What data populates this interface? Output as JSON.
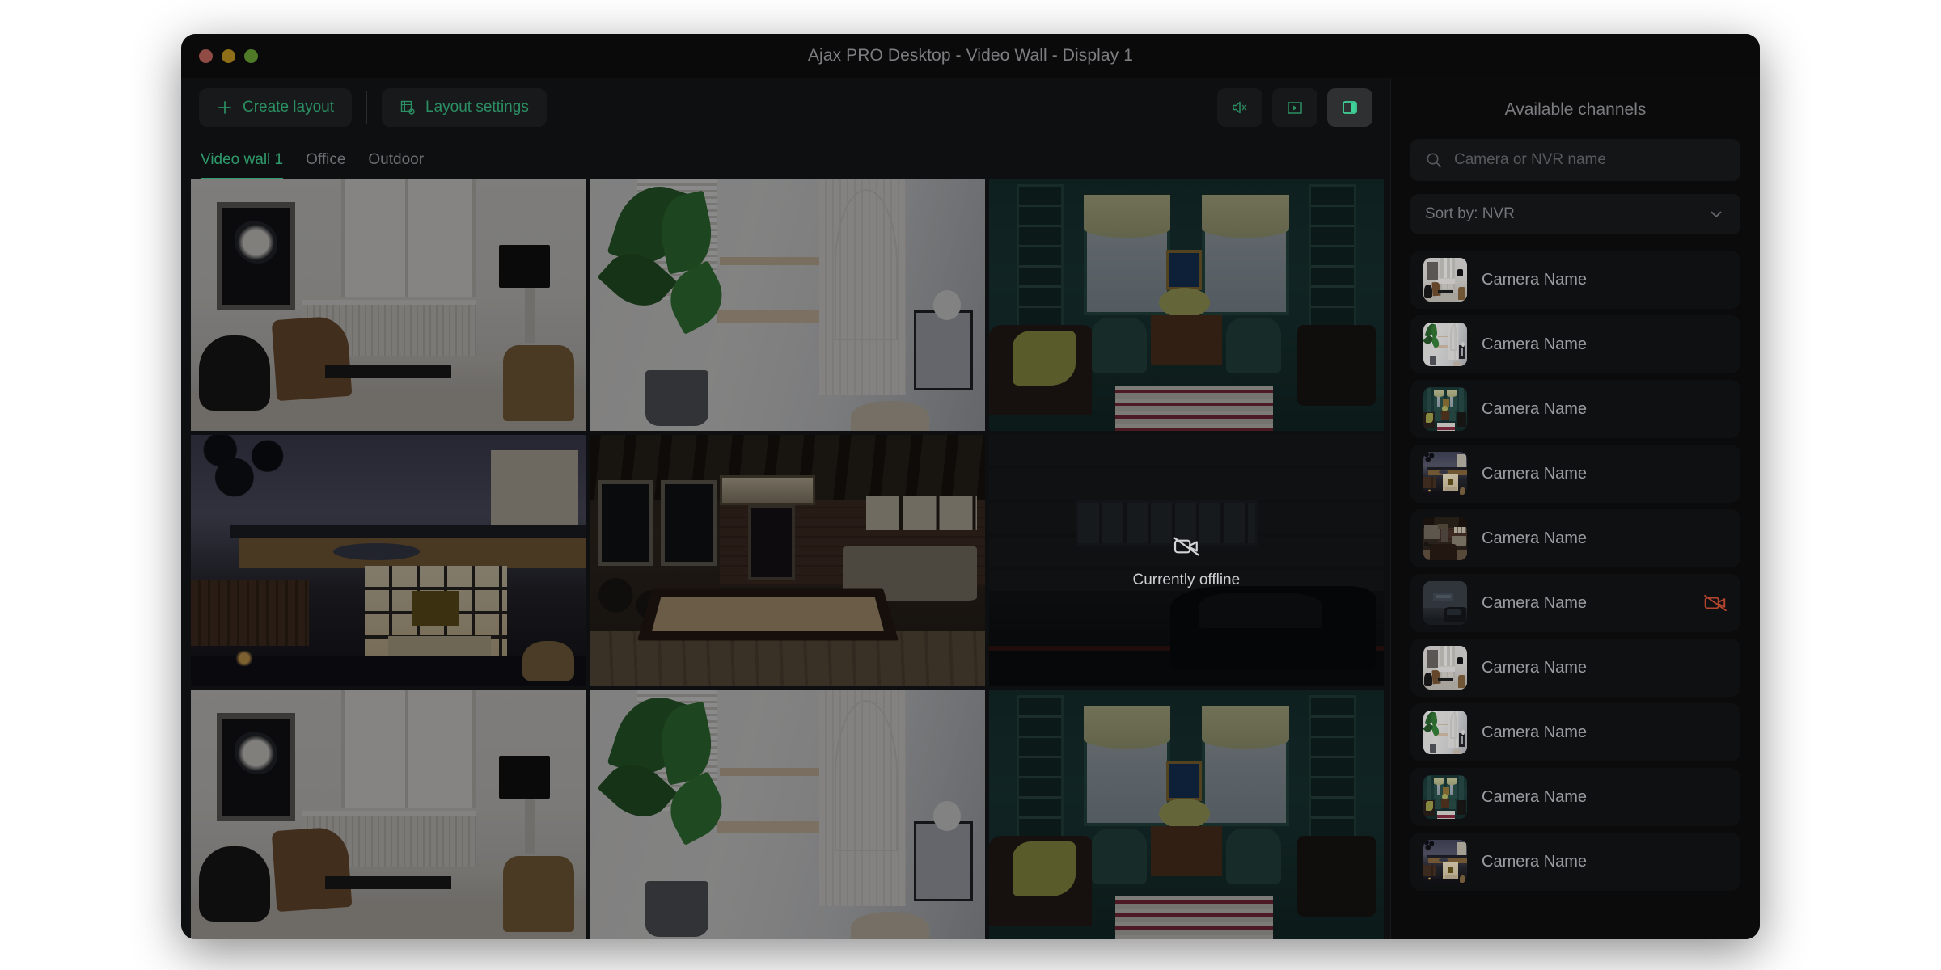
{
  "window": {
    "title": "Ajax PRO Desktop - Video Wall - Display 1",
    "traffic": {
      "close": "close-button",
      "minimize": "minimize-button",
      "maximize": "maximize-button"
    }
  },
  "toolbar": {
    "create_layout": "Create layout",
    "layout_settings": "Layout settings",
    "icons": {
      "create": "plus-icon",
      "settings": "grid-settings-icon",
      "mute": "speaker-muted-icon",
      "play": "play-in-square-icon",
      "panel": "side-panel-toggle-icon"
    }
  },
  "tabs": [
    {
      "label": "Video wall 1",
      "active": true
    },
    {
      "label": "Office",
      "active": false
    },
    {
      "label": "Outdoor",
      "active": false
    }
  ],
  "grid": {
    "tiles": [
      {
        "scene": "living",
        "offline": false
      },
      {
        "scene": "plant",
        "offline": false
      },
      {
        "scene": "green",
        "offline": false
      },
      {
        "scene": "house",
        "offline": false
      },
      {
        "scene": "pool",
        "offline": false
      },
      {
        "scene": "garage",
        "offline": true,
        "status": "Currently offline",
        "icon": "camera-off-icon"
      },
      {
        "scene": "living",
        "offline": false
      },
      {
        "scene": "plant",
        "offline": false
      },
      {
        "scene": "green",
        "offline": false
      }
    ]
  },
  "sidebar": {
    "title": "Available channels",
    "search": {
      "placeholder": "Camera or NVR name",
      "value": "",
      "icon": "search-icon"
    },
    "sort": {
      "label": "Sort by: NVR",
      "icon": "chevron-down-icon"
    },
    "channels": [
      {
        "name": "Camera Name",
        "scene": "living",
        "offline": false
      },
      {
        "name": "Camera Name",
        "scene": "plant",
        "offline": false
      },
      {
        "name": "Camera Name",
        "scene": "green",
        "offline": false
      },
      {
        "name": "Camera Name",
        "scene": "house",
        "offline": false
      },
      {
        "name": "Camera Name",
        "scene": "pool",
        "offline": false
      },
      {
        "name": "Camera Name",
        "scene": "garage",
        "offline": true,
        "status_icon": "camera-off-icon"
      },
      {
        "name": "Camera Name",
        "scene": "living",
        "offline": false
      },
      {
        "name": "Camera Name",
        "scene": "plant",
        "offline": false
      },
      {
        "name": "Camera Name",
        "scene": "green",
        "offline": false
      },
      {
        "name": "Camera Name",
        "scene": "house",
        "offline": false
      }
    ]
  },
  "colors": {
    "accent_green": "#2f9a6b",
    "offline_red": "#b4452f",
    "window_bg": "#0b0b0c",
    "panel_bg": "#0e0f10",
    "text_muted": "#7b7c80"
  }
}
